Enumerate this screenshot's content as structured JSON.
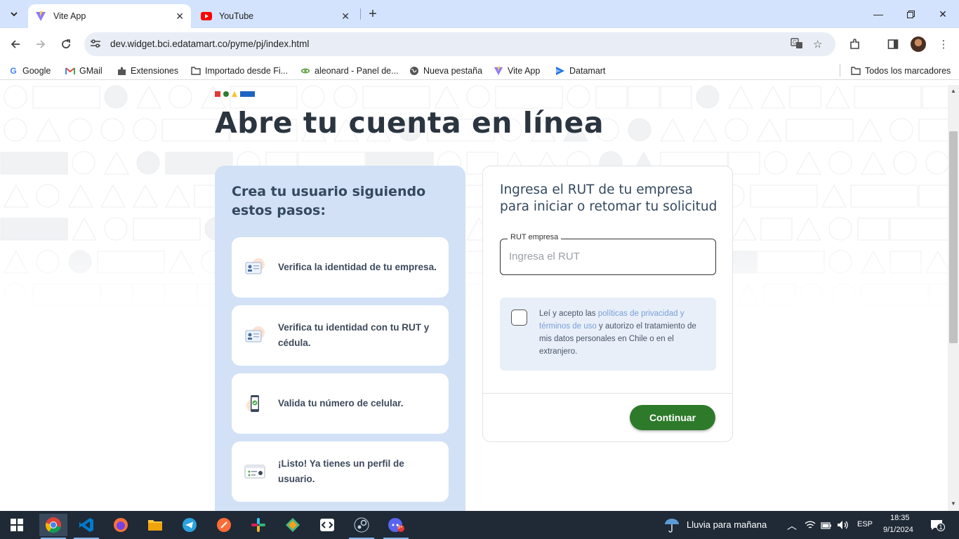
{
  "browser": {
    "tabs": [
      {
        "title": "Vite App",
        "active": true
      },
      {
        "title": "YouTube",
        "active": false
      }
    ],
    "url": "dev.widget.bci.edatamart.co/pyme/pj/index.html",
    "bookmarks": [
      {
        "label": "Google",
        "icon": "google-icon"
      },
      {
        "label": "GMail",
        "icon": "gmail-icon"
      },
      {
        "label": "Extensiones",
        "icon": "puzzle-icon"
      },
      {
        "label": "Importado desde Fi...",
        "icon": "folder-icon"
      },
      {
        "label": "aleonard - Panel de...",
        "icon": "leaf-icon"
      },
      {
        "label": "Nueva pestaña",
        "icon": "globe-icon"
      },
      {
        "label": "Vite App",
        "icon": "vite-icon"
      },
      {
        "label": "Datamart",
        "icon": "datamart-icon"
      }
    ],
    "all_bookmarks": "Todos los marcadores"
  },
  "page": {
    "heading": "Abre tu cuenta en línea",
    "steps_title": "Crea tu usuario siguiendo estos pasos:",
    "steps": [
      {
        "text": "Verifica la identidad de tu empresa.",
        "icon": "id-card-icon"
      },
      {
        "text": "Verifica tu identidad con tu RUT y cédula.",
        "icon": "id-card-icon"
      },
      {
        "text": "Valida tu número de celular.",
        "icon": "phone-check-icon"
      },
      {
        "text": "¡Listo! Ya tienes un perfil de usuario.",
        "icon": "profile-card-icon"
      }
    ],
    "form_title": "Ingresa el RUT de tu empresa para iniciar o retomar tu solicitud",
    "rut_label": "RUT empresa",
    "rut_placeholder": "Ingresa el RUT",
    "rut_value": "",
    "consent_pre": "Leí y acepto las ",
    "consent_link": "políticas de privacidad y términos de uso",
    "consent_post": " y autorizo el tratamiento de mis datos personales en Chile o en el extranjero.",
    "consent_checked": false,
    "continue_label": "Continuar",
    "colors": {
      "accent_green": "#2d7a2b",
      "panel_blue": "#d2e1f5",
      "heading": "#2b3540"
    }
  },
  "taskbar": {
    "weather": "Lluvia para mañana",
    "language": "ESP",
    "time": "18:35",
    "date": "9/1/2024",
    "notifications": "1",
    "discord_badge": "9+"
  }
}
